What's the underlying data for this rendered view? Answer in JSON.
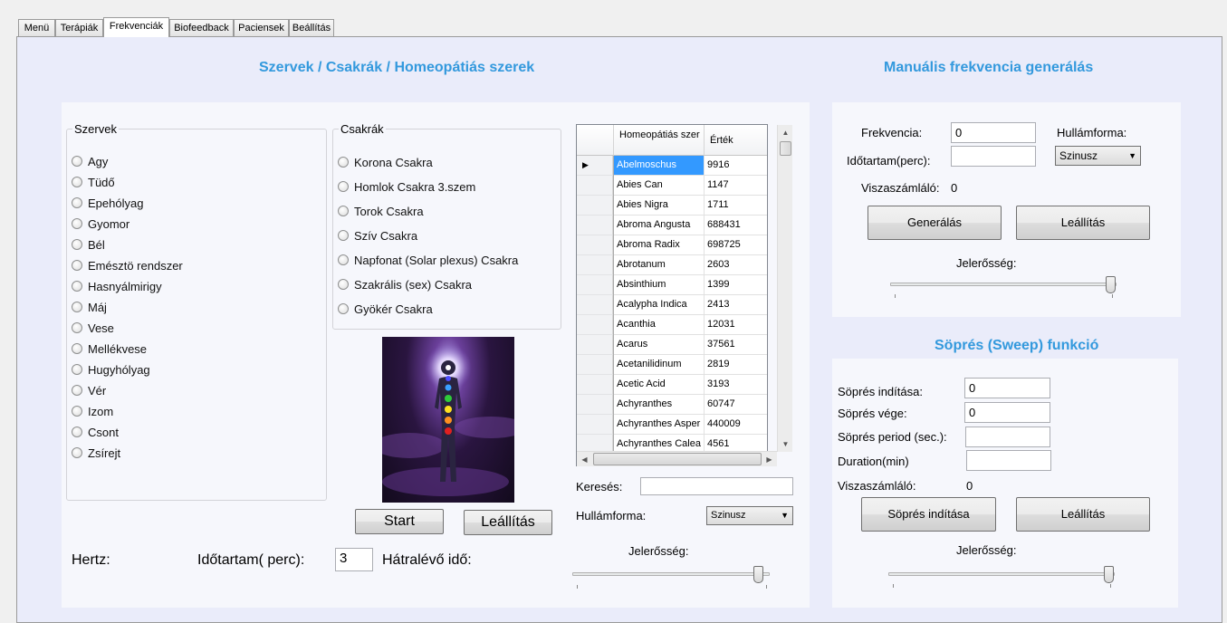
{
  "tabs": [
    "Menü",
    "Terápiák",
    "Frekvenciák",
    "Biofeedback",
    "Paciensek",
    "Beállítás"
  ],
  "active_tab": "Frekvenciák",
  "left_section": {
    "title": "Szervek / Csakrák / Homeopátiás szerek",
    "organs_group": "Szervek",
    "organs": [
      "Agy",
      "Tüdő",
      "Epehólyag",
      "Gyomor",
      "Bél",
      "Emésztö rendszer",
      "Hasnyálmirigy",
      "Máj",
      "Vese",
      "Mellékvese",
      "Hugyhólyag",
      "Vér",
      "Izom",
      "Csont",
      "Zsírejt"
    ],
    "chakras_group": "Csakrák",
    "chakras": [
      "Korona Csakra",
      "Homlok Csakra 3.szem",
      "Torok Csakra",
      "Szív Csakra",
      "Napfonat (Solar plexus) Csakra",
      "Szakrális (sex) Csakra",
      "Gyökér Csakra"
    ],
    "start_label": "Start",
    "stop_label": "Leállítás",
    "hertz_label": "Hertz:",
    "duration_label": "Időtartam( perc):",
    "duration_value": "3",
    "remaining_label": "Hátralévő idő:",
    "grid": {
      "col1": "Homeopátiás szer",
      "col2": "Érték",
      "rows": [
        {
          "name": "Abelmoschus",
          "value": "9916"
        },
        {
          "name": "Abies Can",
          "value": "1147"
        },
        {
          "name": "Abies Nigra",
          "value": "1711"
        },
        {
          "name": "Abroma Angusta",
          "value": "688431"
        },
        {
          "name": "Abroma Radix",
          "value": "698725"
        },
        {
          "name": "Abrotanum",
          "value": "2603"
        },
        {
          "name": "Absinthium",
          "value": "1399"
        },
        {
          "name": "Acalypha Indica",
          "value": "2413"
        },
        {
          "name": "Acanthia",
          "value": "12031"
        },
        {
          "name": "Acarus",
          "value": "37561"
        },
        {
          "name": "Acetanilidinum",
          "value": "2819"
        },
        {
          "name": "Acetic Acid",
          "value": "3193"
        },
        {
          "name": "Achyranthes",
          "value": "60747"
        },
        {
          "name": "Achyranthes Asper",
          "value": "440009"
        },
        {
          "name": "Achyranthes Calea",
          "value": "4561"
        }
      ]
    },
    "search_label": "Keresés:",
    "search_value": "",
    "waveform_label": "Hullámforma:",
    "waveform_value": "Szinusz",
    "intensity_label": "Jelerősség:",
    "intensity_level": 0.95
  },
  "manual_section": {
    "title": "Manuális frekvencia generálás",
    "freq_label": "Frekvencia:",
    "freq_value": "0",
    "waveform_label": "Hullámforma:",
    "waveform_value": "Szinusz",
    "duration_label": "Időtartam(perc):",
    "duration_value": "",
    "countdown_label": "Viszaszámláló:",
    "countdown_value": "0",
    "generate_label": "Generálás",
    "stop_label": "Leállítás",
    "intensity_label": "Jelerősség:",
    "intensity_level": 0.99
  },
  "sweep_section": {
    "title": "Söprés (Sweep) funkció",
    "start_label": "Söprés indítása:",
    "start_value": "0",
    "end_label": "Söprés vége:",
    "end_value": "0",
    "period_label": "Söprés period (sec.):",
    "period_value": "",
    "duration_label": "Duration(min)",
    "duration_value": "",
    "countdown_label": "Viszaszámláló:",
    "countdown_value": "0",
    "start_button": "Söprés indítása",
    "stop_button": "Leállítás",
    "intensity_label": "Jelerősség:",
    "intensity_level": 0.99
  }
}
